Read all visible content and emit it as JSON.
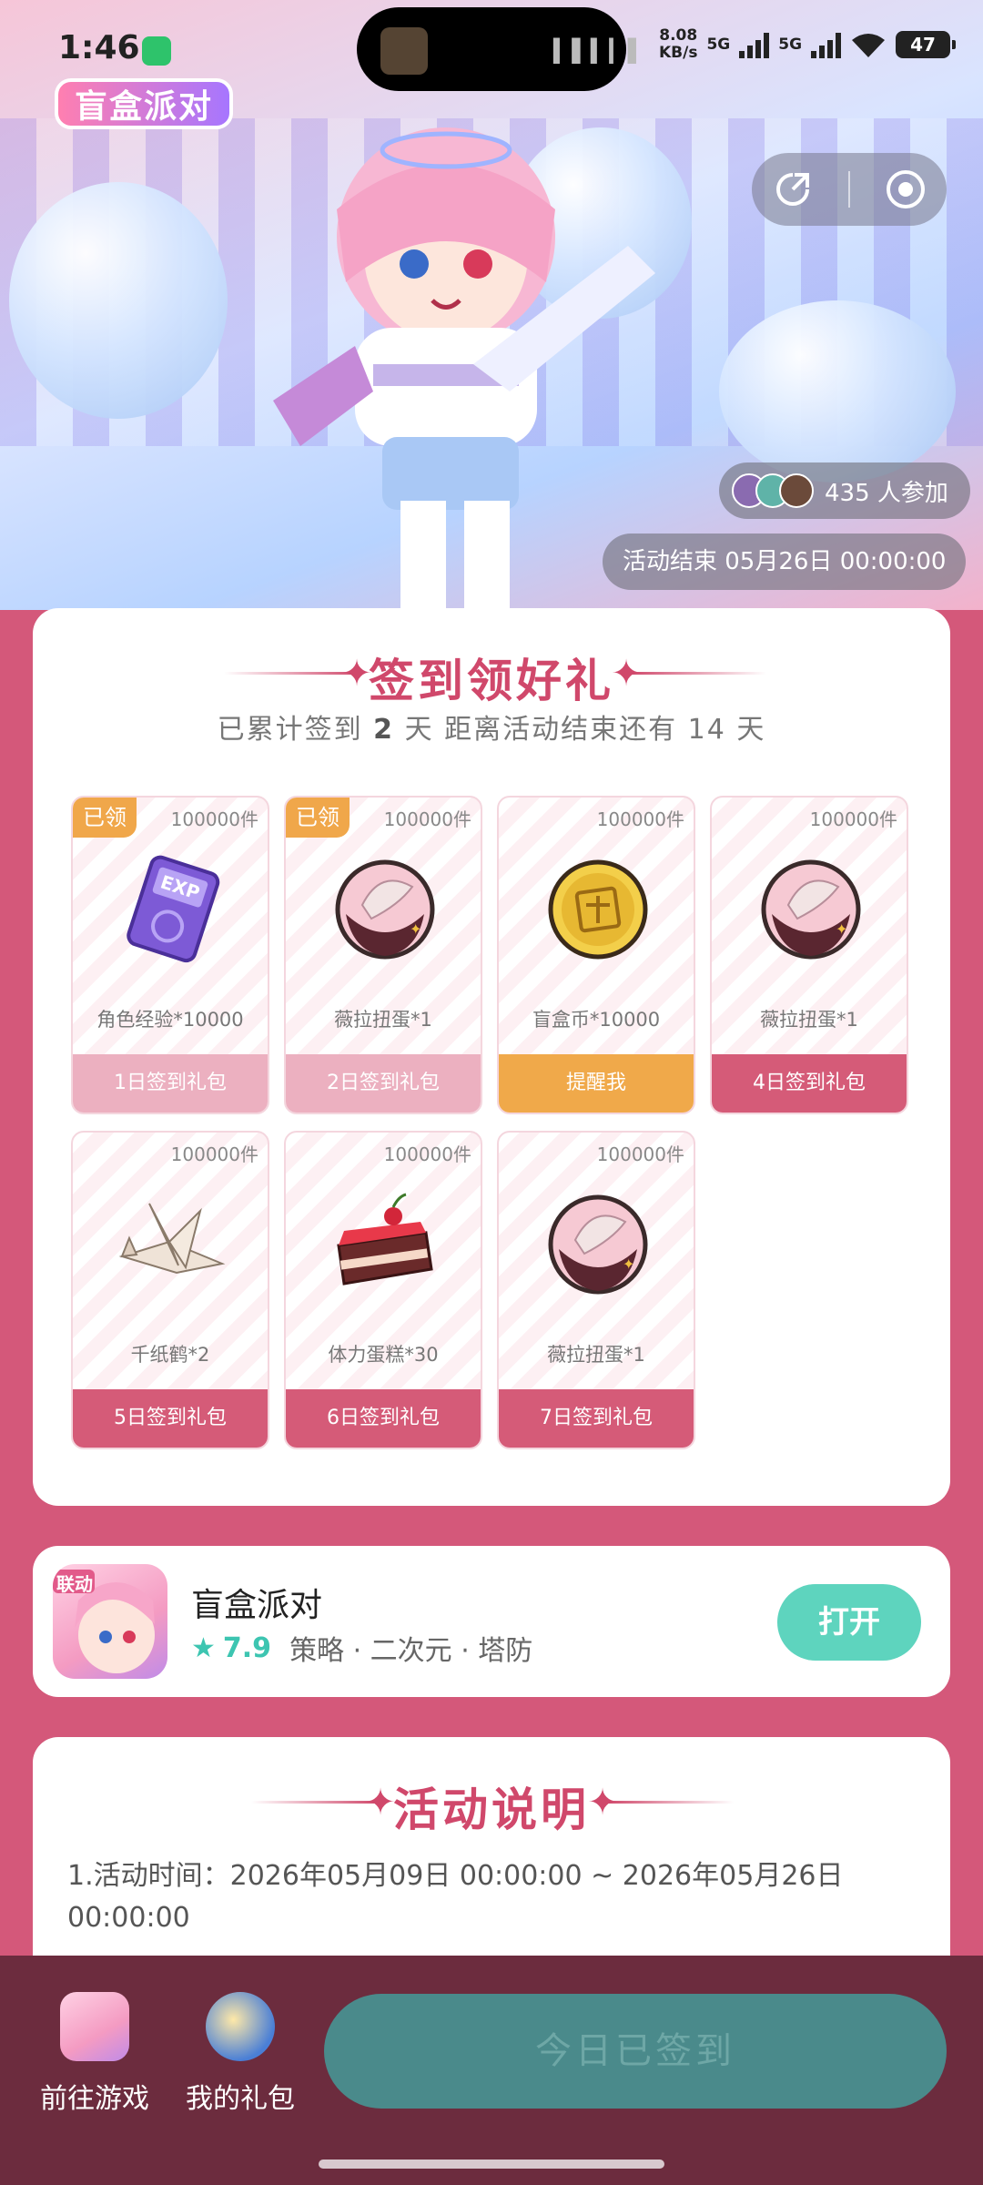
{
  "status_bar": {
    "time": "1:46",
    "net_speed": "8.08",
    "net_unit": "KB/s",
    "sim1": "5G",
    "sim2": "5G",
    "battery": "47"
  },
  "hero": {
    "logo": "盲盒派对",
    "participants_count_text": "435 人参加",
    "end_time": "活动结束 05月26日 00:00:00"
  },
  "checkin": {
    "title": "签到领好礼",
    "info_prefix": "已累计签到",
    "days_signed": "2",
    "info_middle": "天  距离活动结束还有 14 天",
    "claimed_tag": "已领",
    "gifts": [
      {
        "stock": "100000件",
        "name": "角色经验*10000",
        "button": "1日签到礼包",
        "icon": "exp-card-icon"
      },
      {
        "stock": "100000件",
        "name": "薇拉扭蛋*1",
        "button": "2日签到礼包",
        "icon": "gacha-egg-icon"
      },
      {
        "stock": "100000件",
        "name": "盲盒币*10000",
        "button": "提醒我",
        "icon": "blindbox-coin-icon"
      },
      {
        "stock": "100000件",
        "name": "薇拉扭蛋*1",
        "button": "4日签到礼包",
        "icon": "gacha-egg-icon"
      },
      {
        "stock": "100000件",
        "name": "千纸鹤*2",
        "button": "5日签到礼包",
        "icon": "paper-crane-icon"
      },
      {
        "stock": "100000件",
        "name": "体力蛋糕*30",
        "button": "6日签到礼包",
        "icon": "cake-icon"
      },
      {
        "stock": "100000件",
        "name": "薇拉扭蛋*1",
        "button": "7日签到礼包",
        "icon": "gacha-egg-icon"
      }
    ]
  },
  "game": {
    "icon_badge": "联动",
    "name": "盲盒派对",
    "score": "7.9",
    "tags": "策略 · 二次元 · 塔防",
    "open": "打开"
  },
  "rules": {
    "title": "活动说明",
    "line1": "1.活动时间：2026年05月09日 00:00:00 ~ 2026年05月26日 00:00:00"
  },
  "bottom_bar": {
    "go_game": "前往游戏",
    "my_gifts": "我的礼包",
    "main_button": "今日已签到"
  },
  "colors": {
    "brand": "#d0486b",
    "teal": "#5ed4be",
    "orange": "#f0a94a"
  }
}
